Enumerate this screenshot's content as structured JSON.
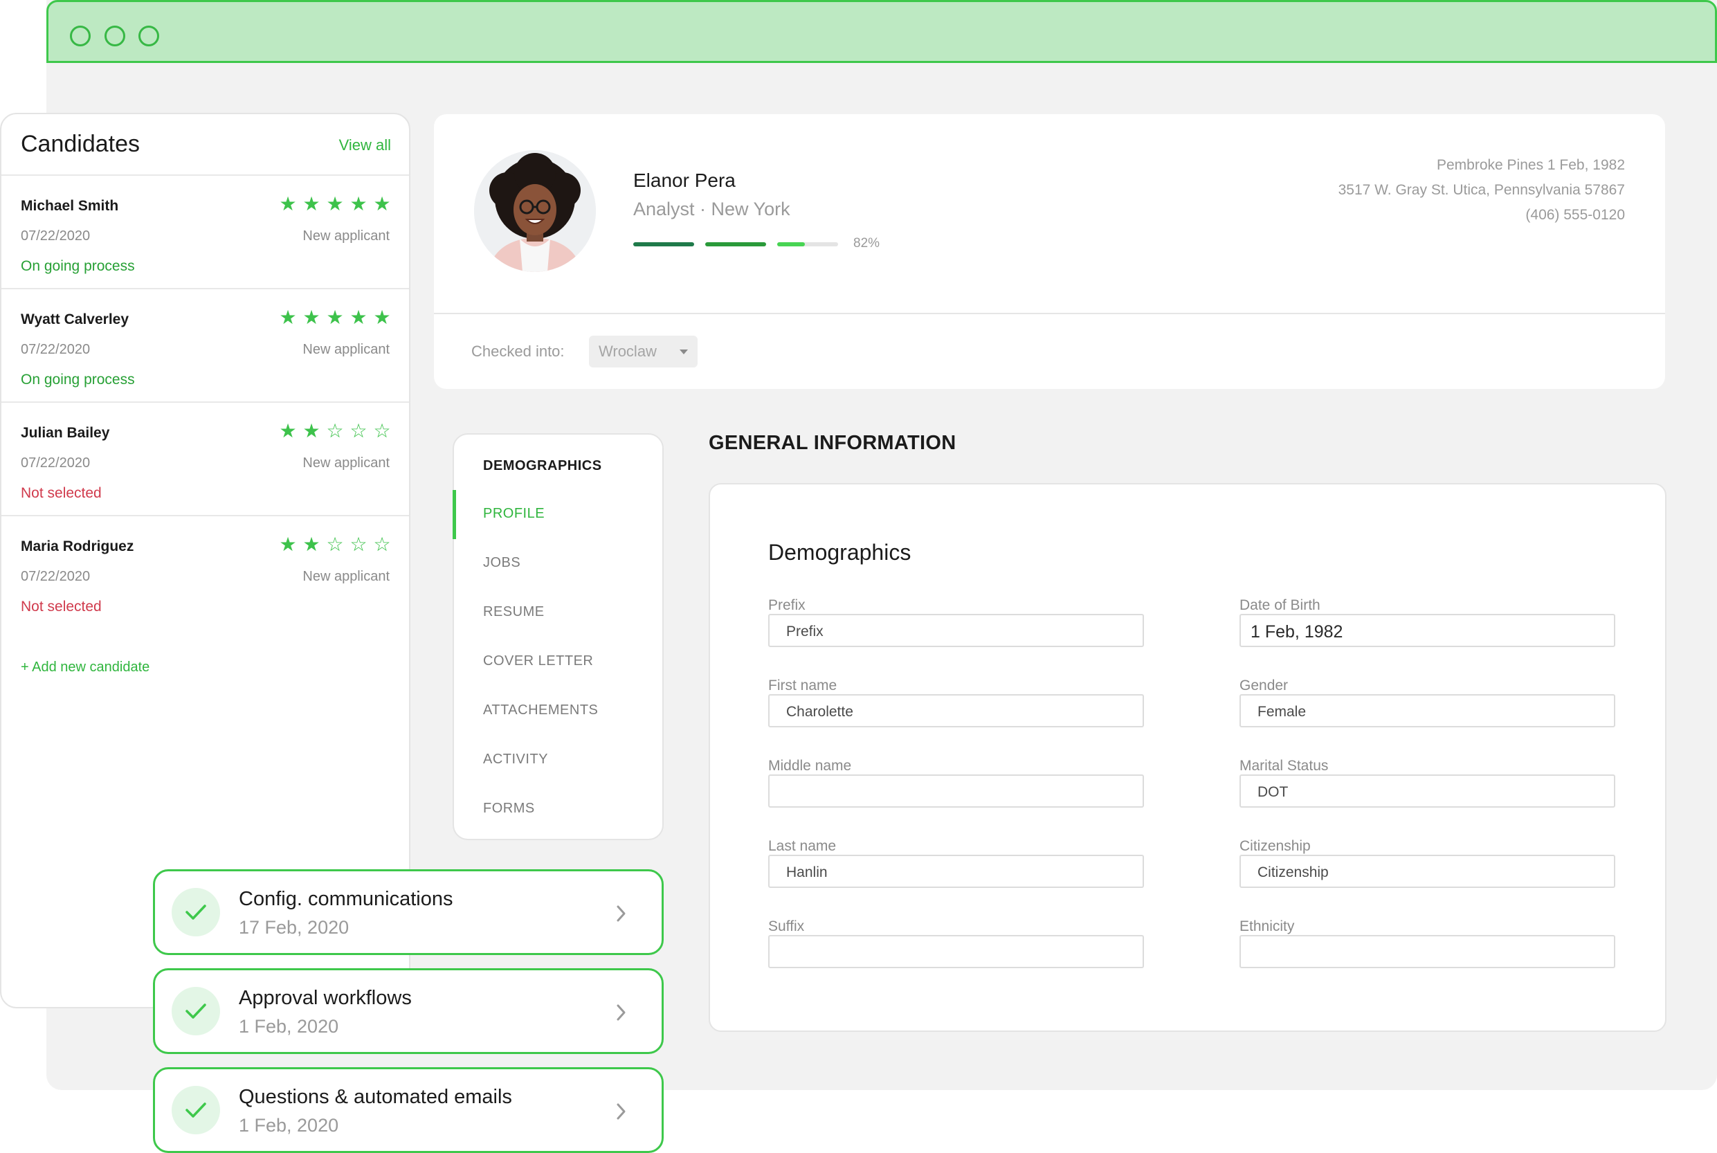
{
  "candidates": {
    "title": "Candidates",
    "view_all": "View all",
    "add_new": "+ Add new candidate",
    "items": [
      {
        "name": "Michael Smith",
        "date": "07/22/2020",
        "type": "New applicant",
        "status": "On going process",
        "status_kind": "ok",
        "rating": 5
      },
      {
        "name": "Wyatt Calverley",
        "date": "07/22/2020",
        "type": "New applicant",
        "status": "On going process",
        "status_kind": "ok",
        "rating": 5
      },
      {
        "name": "Julian Bailey",
        "date": "07/22/2020",
        "type": "New applicant",
        "status": "Not selected",
        "status_kind": "no",
        "rating": 2
      },
      {
        "name": "Maria Rodriguez",
        "date": "07/22/2020",
        "type": "New applicant",
        "status": "Not selected",
        "status_kind": "no",
        "rating": 2
      }
    ]
  },
  "profile": {
    "name": "Elanor Pera",
    "role": "Analyst · New York",
    "progress": 0.82,
    "progress_label": "82%",
    "address": [
      "Pembroke Pines 1 Feb, 1982",
      "3517 W. Gray St. Utica, Pennsylvania 57867",
      "(406) 555-0120"
    ],
    "checked_into_label": "Checked into:",
    "checked_into_value": "Wroclaw"
  },
  "nav": {
    "heading": "DEMOGRAPHICS",
    "items": [
      {
        "label": "PROFILE",
        "active": true
      },
      {
        "label": "JOBS",
        "active": false
      },
      {
        "label": "RESUME",
        "active": false
      },
      {
        "label": "COVER LETTER",
        "active": false
      },
      {
        "label": "ATTACHEMENTS",
        "active": false
      },
      {
        "label": "ACTIVITY",
        "active": false
      },
      {
        "label": "FORMS",
        "active": false
      }
    ]
  },
  "general": {
    "title": "GENERAL INFORMATION",
    "section": "Demographics",
    "left_fields": [
      {
        "label": "Prefix",
        "value": "",
        "placeholder": "Prefix"
      },
      {
        "label": "First name",
        "value": "Charolette",
        "placeholder": ""
      },
      {
        "label": "Middle name",
        "value": "",
        "placeholder": ""
      },
      {
        "label": "Last name",
        "value": "Hanlin",
        "placeholder": ""
      },
      {
        "label": "Suffix",
        "value": "",
        "placeholder": ""
      }
    ],
    "right_fields": [
      {
        "label": "Date of Birth",
        "value": "1 Feb, 1982",
        "placeholder": ""
      },
      {
        "label": "Gender",
        "value": "Female",
        "placeholder": ""
      },
      {
        "label": "Marital Status",
        "value": "DOT",
        "placeholder": ""
      },
      {
        "label": "Citizenship",
        "value": "",
        "placeholder": "Citizenship"
      },
      {
        "label": "Ethnicity",
        "value": "",
        "placeholder": ""
      }
    ]
  },
  "tasks": [
    {
      "title": "Config. communications",
      "date": "17 Feb, 2020"
    },
    {
      "title": "Approval workflows",
      "date": "1 Feb, 2020"
    },
    {
      "title": "Questions & automated emails",
      "date": "1 Feb, 2020"
    }
  ],
  "colors": {
    "accent": "#3ec84b",
    "titlebar": "#bde9c2",
    "ok": "#27a035",
    "no": "#d03a4c",
    "progress": [
      "#1f7a4a",
      "#2a9a3a",
      "#48d453"
    ]
  }
}
